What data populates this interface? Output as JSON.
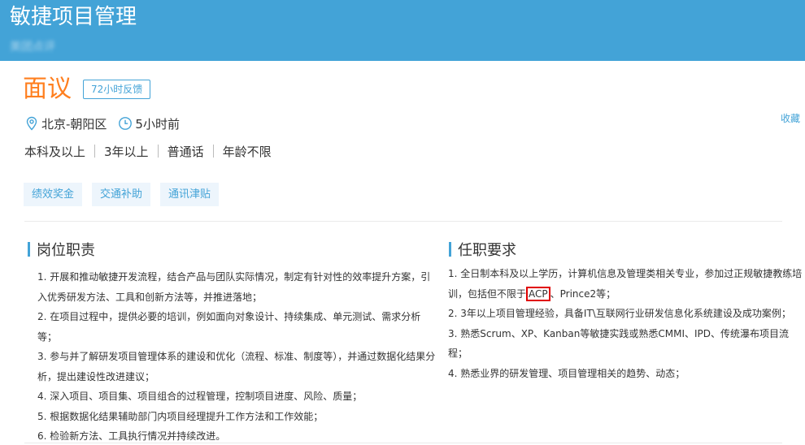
{
  "header": {
    "title": "敏捷项目管理",
    "subtitle": "美团点评"
  },
  "job": {
    "salary": "面议",
    "feedback_badge": "72小时反馈",
    "location": "北京-朝阳区",
    "posted": "5小时前",
    "favorite_label": "收藏",
    "requirements": [
      "本科及以上",
      "3年以上",
      "普通话",
      "年龄不限"
    ],
    "benefits": [
      "绩效奖金",
      "交通补助",
      "通讯津贴"
    ]
  },
  "duties": {
    "title": "岗位职责",
    "items": [
      "1. 开展和推动敏捷开发流程，结合产品与团队实际情况，制定有针对性的效率提升方案，引入优秀研发方法、工具和创新方法等，并推进落地；",
      "2. 在项目过程中，提供必要的培训，例如面向对象设计、持续集成、单元测试、需求分析等；",
      "3. 参与并了解研发项目管理体系的建设和优化（流程、标准、制度等），并通过数据化结果分析，提出建设性改进建议；",
      "4. 深入项目、项目集、项目组合的过程管理，控制项目进度、风险、质量；",
      "5. 根据数据化结果辅助部门内项目经理提升工作方法和工作效能；",
      "6. 检验新方法、工具执行情况并持续改进。"
    ]
  },
  "qualifications": {
    "title": "任职要求",
    "item1_before": "1. 全日制本科及以上学历，计算机信息及管理类相关专业，参加过正规敏捷教练培训，包括但不限于",
    "item1_highlight": "ACP",
    "item1_after": "、Prince2等；",
    "items": [
      "2. 3年以上项目管理经验，具备IT\\互联网行业研发信息化系统建设及成功案例；",
      "3. 熟悉Scrum、XP、Kanban等敏捷实践或熟悉CMMI、IPD、传统瀑布项目流程；",
      "4. 熟悉业界的研发管理、项目管理相关的趋势、动态；"
    ]
  },
  "colors": {
    "header_bg": "#43a3d7",
    "salary": "#ff7f1f",
    "accent": "#43a3d7",
    "highlight_box": "#e00000"
  }
}
